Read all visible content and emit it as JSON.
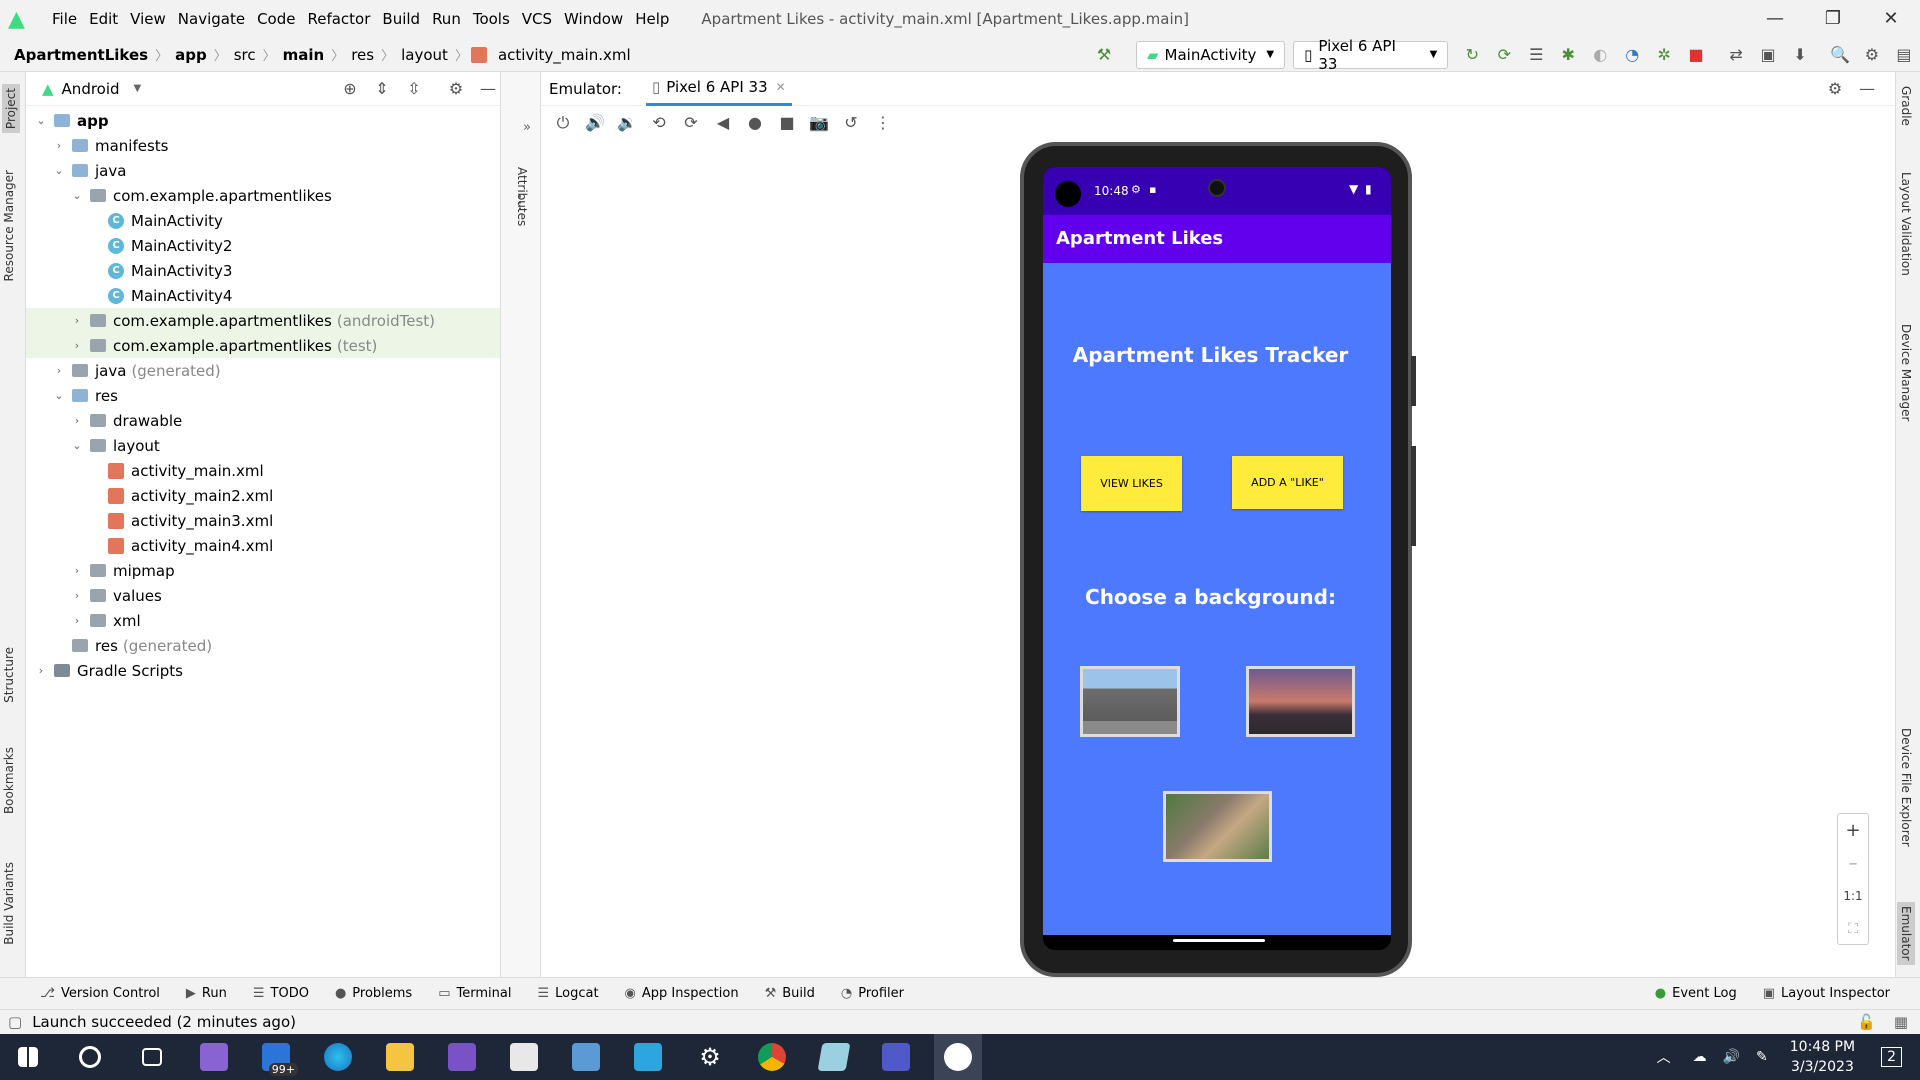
{
  "window": {
    "menu": [
      "File",
      "Edit",
      "View",
      "Navigate",
      "Code",
      "Refactor",
      "Build",
      "Run",
      "Tools",
      "VCS",
      "Window",
      "Help"
    ],
    "title": "Apartment Likes - activity_main.xml [Apartment_Likes.app.main]"
  },
  "breadcrumb": [
    "ApartmentLikes",
    "app",
    "src",
    "main",
    "res",
    "layout",
    "activity_main.xml"
  ],
  "toolbar": {
    "run_config": "MainActivity",
    "device": "Pixel 6 API 33"
  },
  "left_tabs": [
    "Project",
    "Resource Manager",
    "Structure",
    "Bookmarks",
    "Build Variants"
  ],
  "project": {
    "view_mode": "Android",
    "tree": [
      {
        "label": "app",
        "indent": 0,
        "icon": "folder",
        "expanded": true,
        "bold": true
      },
      {
        "label": "manifests",
        "indent": 1,
        "icon": "folder",
        "expanded": false
      },
      {
        "label": "java",
        "indent": 1,
        "icon": "folder",
        "expanded": true
      },
      {
        "label": "com.example.apartmentlikes",
        "indent": 2,
        "icon": "pkg",
        "expanded": true
      },
      {
        "label": "MainActivity",
        "indent": 3,
        "icon": "class"
      },
      {
        "label": "MainActivity2",
        "indent": 3,
        "icon": "class"
      },
      {
        "label": "MainActivity3",
        "indent": 3,
        "icon": "class"
      },
      {
        "label": "MainActivity4",
        "indent": 3,
        "icon": "class"
      },
      {
        "label": "com.example.apartmentlikes",
        "suffix": "(androidTest)",
        "indent": 2,
        "icon": "pkg",
        "expanded": false,
        "highlight": true
      },
      {
        "label": "com.example.apartmentlikes",
        "suffix": "(test)",
        "indent": 2,
        "icon": "pkg",
        "expanded": false,
        "highlight": true
      },
      {
        "label": "java",
        "suffix": "(generated)",
        "indent": 1,
        "icon": "folder-gen",
        "expanded": false
      },
      {
        "label": "res",
        "indent": 1,
        "icon": "folder",
        "expanded": true
      },
      {
        "label": "drawable",
        "indent": 2,
        "icon": "pkg",
        "expanded": false
      },
      {
        "label": "layout",
        "indent": 2,
        "icon": "pkg",
        "expanded": true
      },
      {
        "label": "activity_main.xml",
        "indent": 3,
        "icon": "xml"
      },
      {
        "label": "activity_main2.xml",
        "indent": 3,
        "icon": "xml"
      },
      {
        "label": "activity_main3.xml",
        "indent": 3,
        "icon": "xml"
      },
      {
        "label": "activity_main4.xml",
        "indent": 3,
        "icon": "xml"
      },
      {
        "label": "mipmap",
        "indent": 2,
        "icon": "pkg",
        "expanded": false
      },
      {
        "label": "values",
        "indent": 2,
        "icon": "pkg",
        "expanded": false
      },
      {
        "label": "xml",
        "indent": 2,
        "icon": "pkg",
        "expanded": false
      },
      {
        "label": "res",
        "suffix": "(generated)",
        "indent": 1,
        "icon": "folder-gen"
      },
      {
        "label": "Gradle Scripts",
        "indent": 0,
        "icon": "gradle",
        "expanded": false
      }
    ]
  },
  "attributes_tab": "Attributes",
  "emulator": {
    "label": "Emulator:",
    "tab": "Pixel 6 API 33"
  },
  "phone": {
    "time": "10:48",
    "app_title": "Apartment Likes",
    "heading": "Apartment Likes Tracker",
    "button_view": "VIEW LIKES",
    "button_add": "ADD A \"LIKE\"",
    "subheading": "Choose a background:"
  },
  "right_tabs": [
    "Gradle",
    "Layout Validation",
    "Device Manager",
    "Device File Explorer",
    "Emulator"
  ],
  "zoom": {
    "plus": "+",
    "minus": "–",
    "one": "1:1"
  },
  "bottom_tabs": [
    "Version Control",
    "Run",
    "TODO",
    "Problems",
    "Terminal",
    "Logcat",
    "App Inspection",
    "Build",
    "Profiler"
  ],
  "bottom_right_tabs": [
    "Event Log",
    "Layout Inspector"
  ],
  "status": "Launch succeeded (2 minutes ago)",
  "taskbar": {
    "badge": "99+",
    "time": "10:48 PM",
    "date": "3/3/2023",
    "notif": "2"
  }
}
